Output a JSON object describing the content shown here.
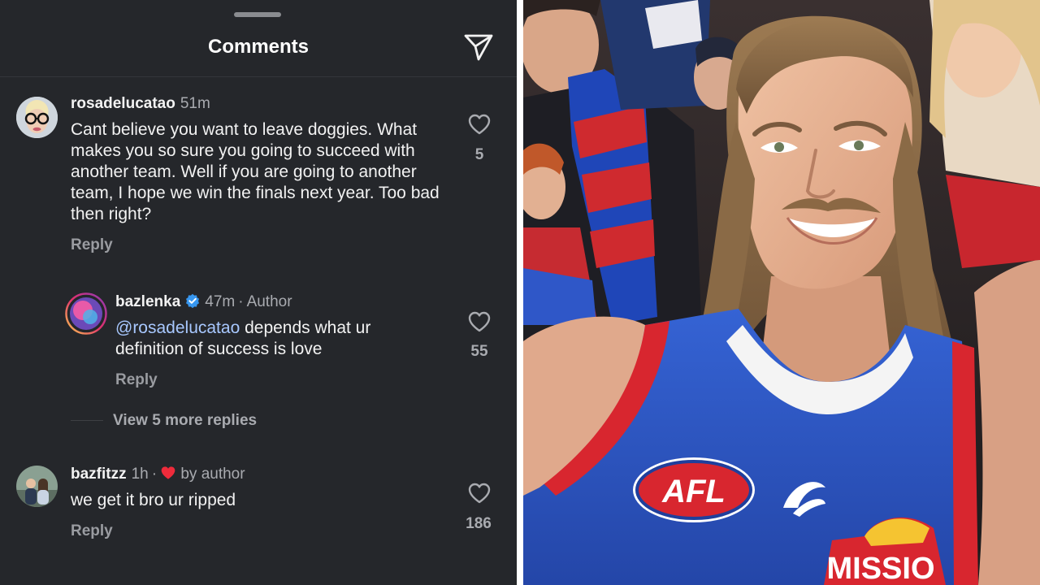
{
  "header": {
    "title": "Comments",
    "send_icon": "paper-plane-icon"
  },
  "comments": [
    {
      "username": "rosadelucatao",
      "time": "51m",
      "text": "Cant believe you want to leave doggies. What makes you so sure you going to succeed with another team. Well if you are going to another team, I hope we win the finals next year. Too bad then right?",
      "reply_label": "Reply",
      "likes": "5"
    },
    {
      "username": "bazlenka",
      "time": "47m",
      "author_tag": "Author",
      "mention": "@rosadelucatao",
      "text": " depends what ur definition of success is love",
      "reply_label": "Reply",
      "likes": "55",
      "verified": true
    },
    {
      "username": "bazfitzz",
      "time": "1h",
      "liked_by": "by author",
      "text": "we get it bro ur ripped",
      "reply_label": "Reply",
      "likes": "186"
    }
  ],
  "view_more": "View 5 more replies",
  "photo": {
    "logo_text": "AFL",
    "sponsor_text": "MISSIO"
  },
  "colors": {
    "panel_bg": "#25272b",
    "jersey_blue": "#2f55c8",
    "jersey_red": "#d8262f",
    "verified_blue": "#3797f0",
    "heart_red": "#ee2b3b"
  }
}
